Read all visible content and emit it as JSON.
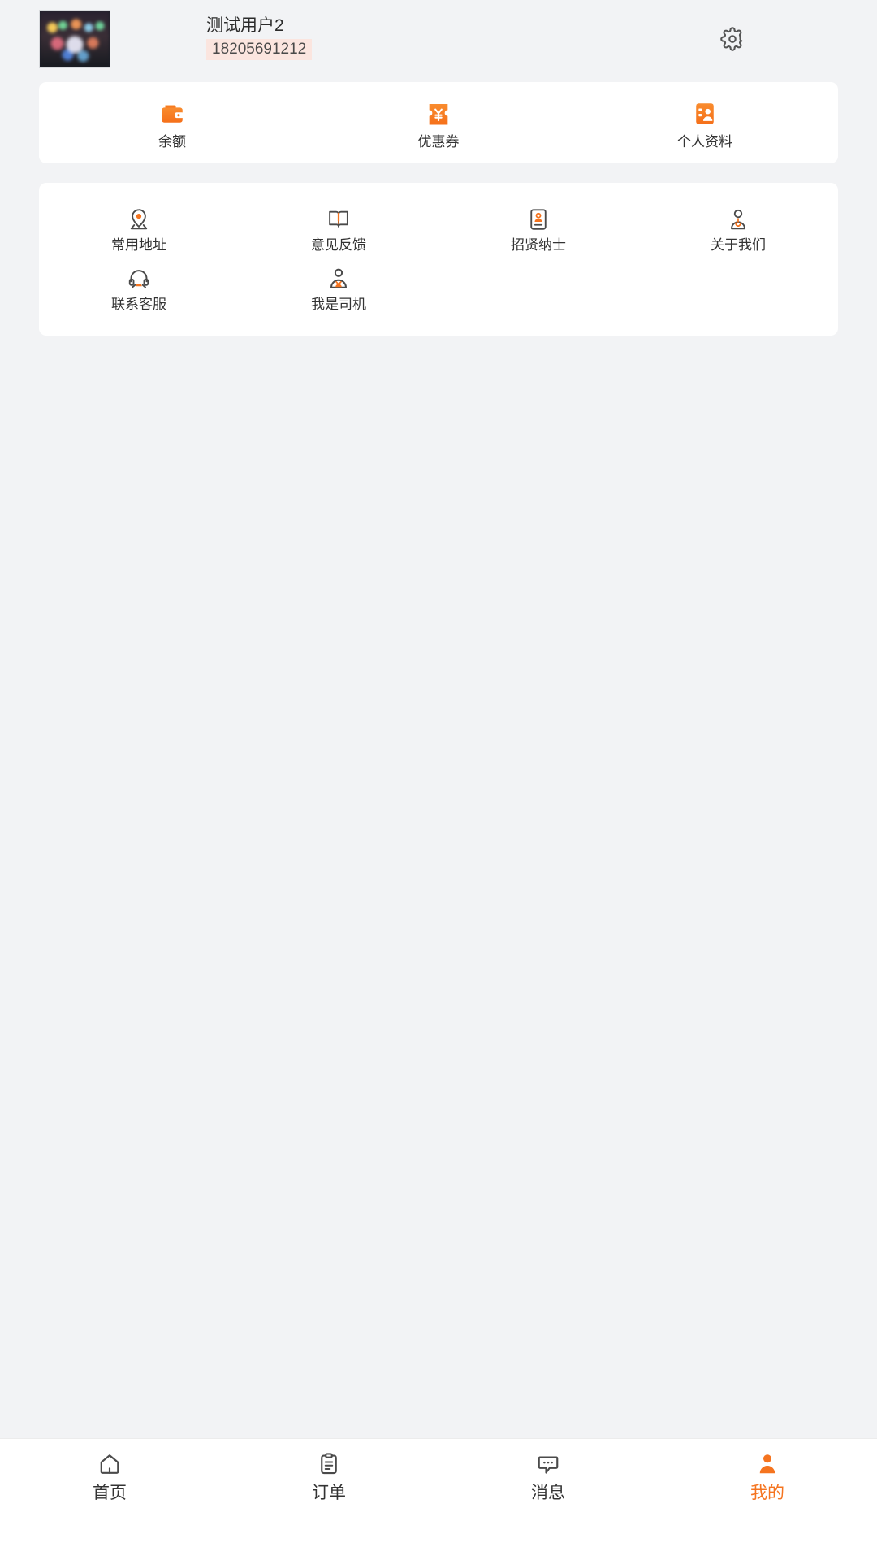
{
  "theme": {
    "accent": "#f5741f",
    "page_bg": "#f2f3f5",
    "card_bg": "#ffffff",
    "icon_gray": "#4a4a4a",
    "phone_badge_bg": "#fbe5df"
  },
  "header": {
    "avatar_name": "user-avatar",
    "username": "测试用户2",
    "phone": "18205691212",
    "settings_icon": "gear-icon"
  },
  "quick_actions": [
    {
      "icon": "wallet-icon",
      "label": "余额"
    },
    {
      "icon": "coupon-icon",
      "label": "优惠券"
    },
    {
      "icon": "id-card-icon",
      "label": "个人资料"
    }
  ],
  "menu_grid": [
    {
      "icon": "location-pin-icon",
      "label": "常用地址"
    },
    {
      "icon": "open-book-icon",
      "label": "意见反馈"
    },
    {
      "icon": "resume-icon",
      "label": "招贤纳士"
    },
    {
      "icon": "people-icon",
      "label": "关于我们"
    },
    {
      "icon": "headset-icon",
      "label": "联系客服"
    },
    {
      "icon": "driver-icon",
      "label": "我是司机"
    }
  ],
  "tabbar": [
    {
      "icon": "home-icon",
      "label": "首页",
      "active": false
    },
    {
      "icon": "order-icon",
      "label": "订单",
      "active": false
    },
    {
      "icon": "message-icon",
      "label": "消息",
      "active": false
    },
    {
      "icon": "profile-icon",
      "label": "我的",
      "active": true
    }
  ]
}
